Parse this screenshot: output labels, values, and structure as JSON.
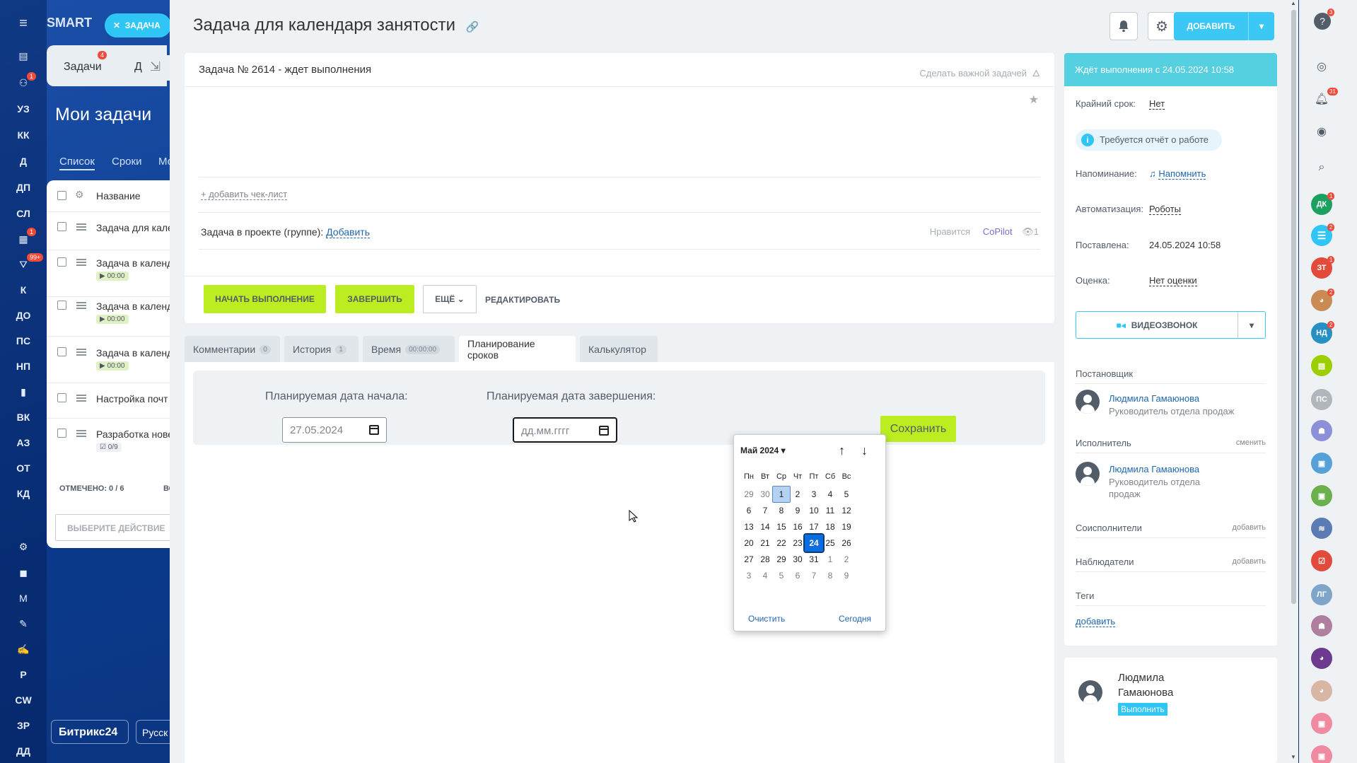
{
  "background": {
    "logo": "SMART",
    "task_chip": "ЗАДАЧА",
    "tabs": [
      "Задачи",
      "Д"
    ],
    "tab_badge": "4",
    "page_title": "Мои задачи",
    "subnav": [
      "Список",
      "Сроки",
      "Мо"
    ],
    "list_header": "Название",
    "rows": [
      {
        "title": "Задача для кале",
        "timer": ""
      },
      {
        "title": "Задача в календ",
        "timer": "00:00"
      },
      {
        "title": "Задача в календ",
        "timer": "00:00"
      },
      {
        "title": "Задача в календ",
        "timer": "00:00"
      },
      {
        "title": "Настройка почт",
        "timer": ""
      },
      {
        "title": "Разработка нове",
        "timer": "0/9"
      }
    ],
    "selected_count": "ОТМЕЧЕНО: 0 / 6",
    "selected_extra": "ВС",
    "action_select": "ВЫБЕРИТЕ ДЕЙСТВИЕ",
    "b24_label": "Битрикс24",
    "lang_label": "Русск",
    "nav_items": [
      "УЗ",
      "КК",
      "Д",
      "ДП",
      "СЛ",
      "К",
      "ДО",
      "ПС",
      "НП",
      "ВК",
      "АЗ",
      "ОТ",
      "КД",
      "Р",
      "CW",
      "ЗР",
      "ДД"
    ],
    "nav_badges": {
      "robot": "1",
      "calendar": "1",
      "filter": "99+"
    }
  },
  "header": {
    "title": "Задача для календаря занятости",
    "add_label": "ДОБАВИТЬ"
  },
  "task": {
    "heading": "Задача № 2614 - ждет выполнения",
    "make_important": "Сделать важной задачей",
    "add_checklist": "+ добавить чек-лист",
    "project_label": "Задача в проекте (группе):",
    "project_add": "Добавить",
    "likes_label": "Нравится",
    "copilot": "CoPilot",
    "views": "1"
  },
  "actions": {
    "start": "НАЧАТЬ ВЫПОЛНЕНИЕ",
    "finish": "ЗАВЕРШИТЬ",
    "more": "ЕЩЁ",
    "edit": "РЕДАКТИРОВАТЬ"
  },
  "tabs": [
    {
      "label": "Комментарии",
      "count": "0"
    },
    {
      "label": "История",
      "count": "1"
    },
    {
      "label": "Время",
      "count": "00:00:00"
    },
    {
      "label": "Планирование сроков",
      "count": ""
    },
    {
      "label": "Калькулятор",
      "count": ""
    }
  ],
  "planning": {
    "start_label": "Планируемая дата начала:",
    "start_value": "27.05.2024",
    "end_label": "Планируемая дата завершения:",
    "end_placeholder": "дд.мм.гггг",
    "save": "Сохранить"
  },
  "calendar": {
    "month": "Май 2024",
    "weekdays": [
      "Пн",
      "Вт",
      "Ср",
      "Чт",
      "Пт",
      "Сб",
      "Вс"
    ],
    "weeks": [
      [
        "29",
        "30",
        "1",
        "2",
        "3",
        "4",
        "5"
      ],
      [
        "6",
        "7",
        "8",
        "9",
        "10",
        "11",
        "12"
      ],
      [
        "13",
        "14",
        "15",
        "16",
        "17",
        "18",
        "19"
      ],
      [
        "20",
        "21",
        "22",
        "23",
        "24",
        "25",
        "26"
      ],
      [
        "27",
        "28",
        "29",
        "30",
        "31",
        "1",
        "2"
      ],
      [
        "3",
        "4",
        "5",
        "6",
        "7",
        "8",
        "9"
      ]
    ],
    "clear": "Очистить",
    "today": "Сегодня"
  },
  "sidebar": {
    "status": "Ждёт выполнения с 24.05.2024 10:58",
    "deadline_label": "Крайний срок:",
    "deadline_value": "Нет",
    "report_required": "Требуется отчёт о работе",
    "reminder_label": "Напоминание:",
    "reminder_value": "Напомнить",
    "automation_label": "Автоматизация:",
    "automation_value": "Роботы",
    "created_label": "Поставлена:",
    "created_value": "24.05.2024 10:58",
    "rating_label": "Оценка:",
    "rating_value": "Нет оценки",
    "video_call": "ВИДЕОЗВОНОК",
    "creator_label": "Постановщик",
    "creator_name": "Людмила Гамаюнова",
    "creator_role": "Руководитель отдела продаж",
    "assignee_label": "Исполнитель",
    "assignee_change": "сменить",
    "assignee_name": "Людмила Гамаюнова",
    "assignee_role": "Руководитель отдела продаж",
    "coexec_label": "Соисполнители",
    "coexec_add": "добавить",
    "observers_label": "Наблюдатели",
    "observers_add": "добавить",
    "tags_label": "Теги",
    "tags_add": "добавить",
    "bottom_name": "Людмила Гамаюнова",
    "bottom_badge": "Выполнить"
  },
  "rightbar": {
    "help_badge": "3",
    "bell_badge": "31",
    "avatars": [
      {
        "initials": "ДК",
        "color": "#1aa15f",
        "badge": "1"
      },
      {
        "initials": "ЗТ",
        "color": "#e24b3b",
        "badge": "1"
      },
      {
        "initials": "НД",
        "color": "#2790c3",
        "badge": "2"
      },
      {
        "initials": "ПС",
        "color": "#b0b6bc",
        "badge": ""
      },
      {
        "initials": "ЛГ",
        "color": "#7fa6c9",
        "badge": ""
      }
    ]
  }
}
